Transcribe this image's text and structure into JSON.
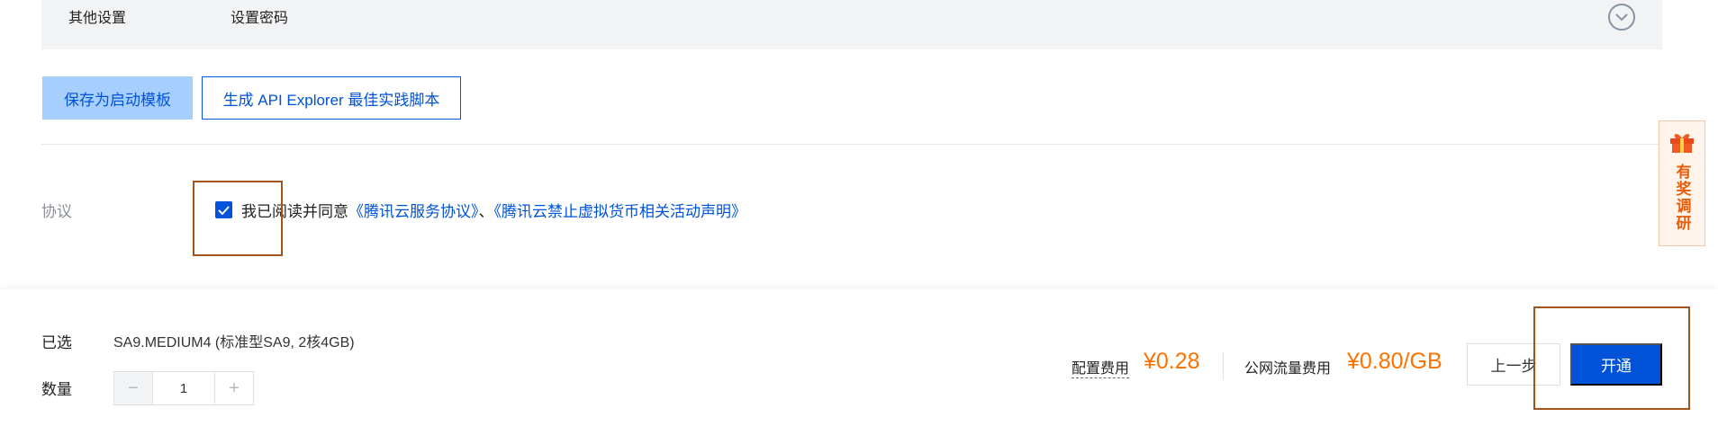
{
  "other_settings": {
    "title": "其他设置",
    "subtitle": "设置密码"
  },
  "actions": {
    "save_template": "保存为启动模板",
    "api_explorer": "生成 API Explorer 最佳实践脚本"
  },
  "agreement": {
    "label": "协议",
    "checked": true,
    "prefix": "我已阅读并同意",
    "link1": "《腾讯云服务协议》",
    "separator": "、",
    "link2": "《腾讯云禁止虚拟货币相关活动声明》"
  },
  "survey": {
    "label": "有奖调研"
  },
  "summary": {
    "selected_label": "已选",
    "selected_value": "SA9.MEDIUM4 (标准型SA9, 2核4GB)",
    "quantity_label": "数量",
    "quantity": "1",
    "config_fee_label": "配置费用",
    "config_fee": "¥0.28",
    "traffic_fee_label": "公网流量费用",
    "traffic_fee": "¥0.80/GB",
    "prev_button": "上一步",
    "submit_button": "开通"
  },
  "colors": {
    "primary": "#0052d9",
    "price": "#ff7200",
    "highlight": "#a0531b"
  }
}
